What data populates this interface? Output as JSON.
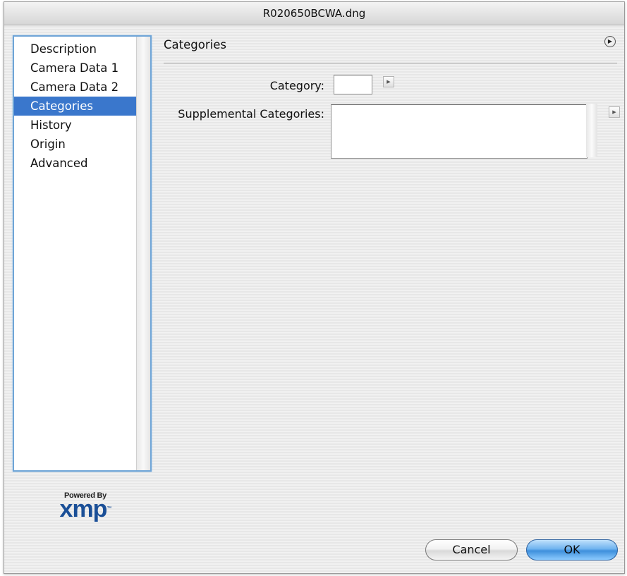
{
  "window": {
    "title": "R020650BCWA.dng"
  },
  "sidebar": {
    "items": [
      {
        "label": "Description",
        "selected": false
      },
      {
        "label": "Camera Data 1",
        "selected": false
      },
      {
        "label": "Camera Data 2",
        "selected": false
      },
      {
        "label": "Categories",
        "selected": true
      },
      {
        "label": "History",
        "selected": false
      },
      {
        "label": "Origin",
        "selected": false
      },
      {
        "label": "Advanced",
        "selected": false
      }
    ]
  },
  "panel": {
    "title": "Categories",
    "menu_icon": "circle-arrow-right-icon"
  },
  "form": {
    "category_label": "Category:",
    "category_value": "",
    "supplemental_label": "Supplemental Categories:",
    "supplemental_value": ""
  },
  "logo": {
    "powered_by": "Powered By",
    "brand": "xmp",
    "trademark": "™"
  },
  "buttons": {
    "cancel_label": "Cancel",
    "ok_label": "OK"
  },
  "colors": {
    "selection": "#3a77cc",
    "focus_ring": "#6fa5d7",
    "default_button": "#3e8fdc",
    "xmp_logo": "#1a4f97"
  }
}
